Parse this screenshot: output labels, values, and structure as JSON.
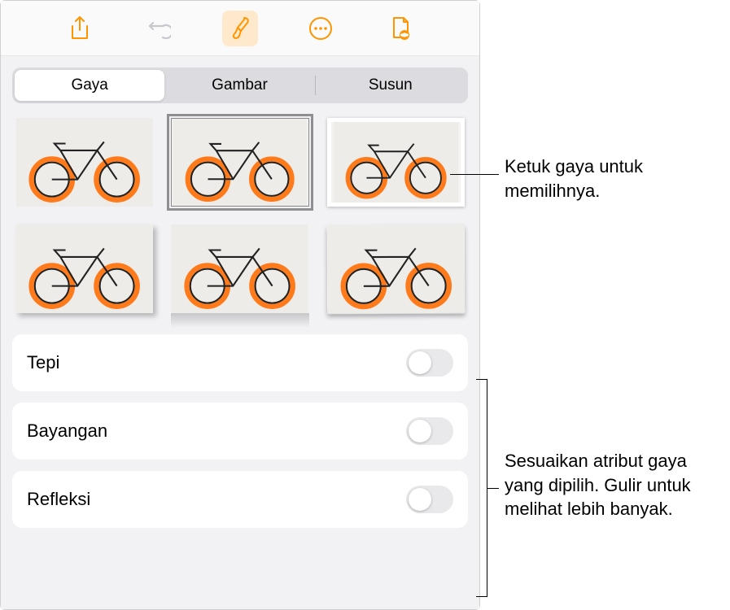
{
  "toolbar": {
    "share_icon": "share-icon",
    "undo_icon": "undo-icon",
    "brush_icon": "brush-icon",
    "more_icon": "more-icon",
    "view_icon": "document-view-icon"
  },
  "tabs": {
    "items": [
      "Gaya",
      "Gambar",
      "Susun"
    ],
    "selected": 0
  },
  "styles": {
    "thumbs": [
      {
        "variant": "plain"
      },
      {
        "variant": "selected-border"
      },
      {
        "variant": "thick-white"
      },
      {
        "variant": "drop-shadow"
      },
      {
        "variant": "reflection"
      },
      {
        "variant": "paper"
      }
    ],
    "selected_index": 1
  },
  "settings": [
    {
      "label": "Tepi",
      "on": false
    },
    {
      "label": "Bayangan",
      "on": false
    },
    {
      "label": "Refleksi",
      "on": false
    }
  ],
  "callouts": {
    "top": "Ketuk gaya untuk memilihnya.",
    "bottom": "Sesuaikan atribut gaya yang dipilih. Gulir untuk melihat lebih banyak."
  }
}
